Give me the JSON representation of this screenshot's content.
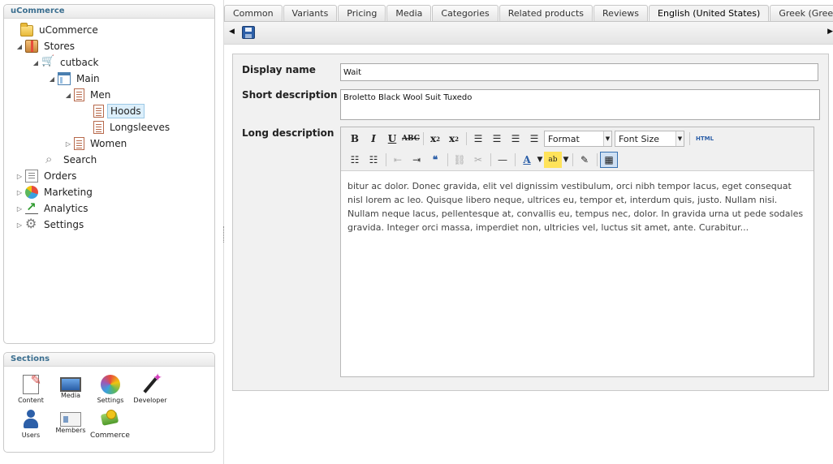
{
  "tree_panel": {
    "title": "uCommerce",
    "nodes": [
      {
        "label": "uCommerce"
      },
      {
        "label": "Stores"
      },
      {
        "label": "cutback"
      },
      {
        "label": "Main"
      },
      {
        "label": "Men"
      },
      {
        "label": "Hoods"
      },
      {
        "label": "Longsleeves"
      },
      {
        "label": "Women"
      },
      {
        "label": "Search"
      },
      {
        "label": "Orders"
      },
      {
        "label": "Marketing"
      },
      {
        "label": "Analytics"
      },
      {
        "label": "Settings"
      }
    ]
  },
  "sections_panel": {
    "title": "Sections",
    "items": [
      {
        "label": "Content"
      },
      {
        "label": "Media"
      },
      {
        "label": "Settings"
      },
      {
        "label": "Developer"
      },
      {
        "label": "Users"
      },
      {
        "label": "Members"
      },
      {
        "label": "Commerce"
      }
    ]
  },
  "tabs": [
    {
      "label": "Common"
    },
    {
      "label": "Variants"
    },
    {
      "label": "Pricing"
    },
    {
      "label": "Media"
    },
    {
      "label": "Categories"
    },
    {
      "label": "Related products"
    },
    {
      "label": "Reviews"
    },
    {
      "label": "English (United States)"
    },
    {
      "label": "Greek (Greece)"
    }
  ],
  "form": {
    "display_name_label": "Display name",
    "display_name_value": "Wait",
    "short_description_label": "Short description",
    "short_description_value": "Broletto Black Wool Suit Tuxedo",
    "long_description_label": "Long description",
    "editor": {
      "format_label": "Format",
      "font_size_label": "Font Size",
      "html_label": "HTML",
      "content": "bitur ac dolor. Donec gravida, elit vel dignissim vestibulum, orci nibh tempor lacus, eget consequat nisl lorem ac leo. Quisque libero neque, ultrices eu, tempor et, interdum quis, justo. Nullam nisi. Nullam neque lacus, pellentesque at, convallis eu, tempus nec, dolor. In gravida urna ut pede sodales gravida. Integer orci massa, imperdiet non, ultricies vel, luctus sit amet, ante. Curabitur..."
    }
  }
}
